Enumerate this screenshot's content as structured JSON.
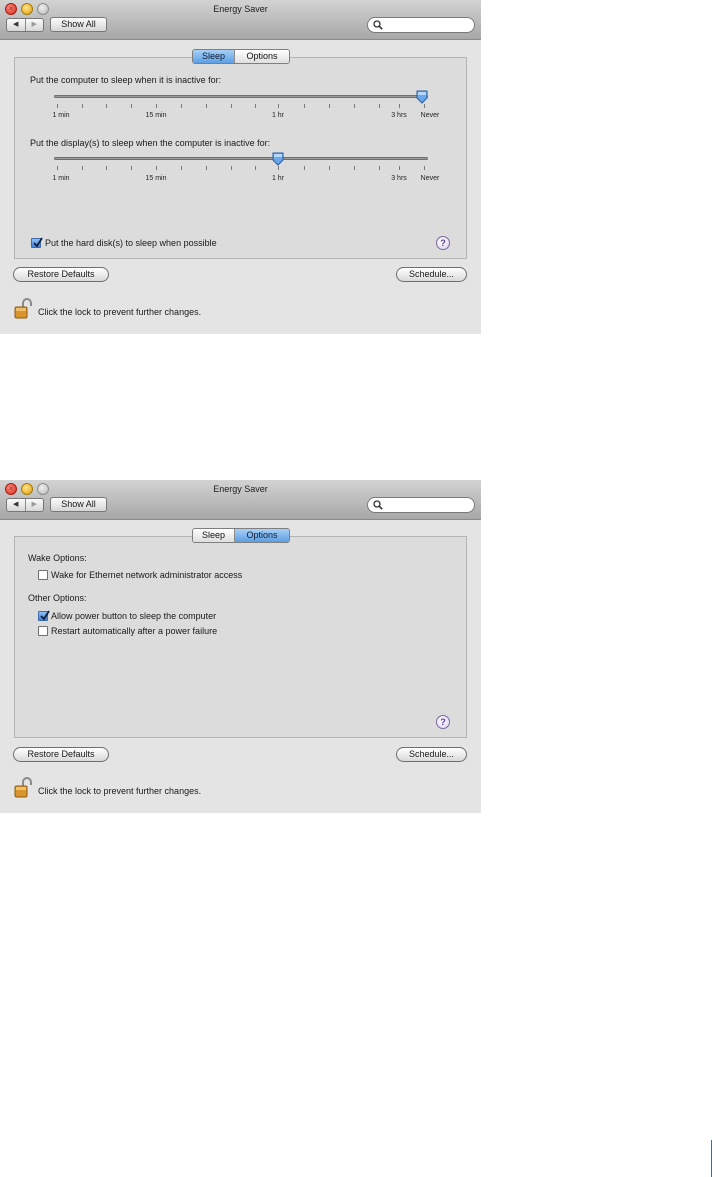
{
  "common": {
    "window_title": "Energy Saver",
    "show_all_label": "Show All",
    "tab_sleep_label": "Sleep",
    "tab_options_label": "Options",
    "restore_defaults_label": "Restore Defaults",
    "schedule_label": "Schedule...",
    "lock_text": "Click the lock to prevent further changes.",
    "help_glyph": "?",
    "icons": {
      "close": "close-light-icon",
      "minimize": "minimize-light-icon",
      "zoom": "zoom-light-icon",
      "back": "back-arrow-icon",
      "forward": "forward-arrow-icon",
      "search": "search-icon",
      "lock": "open-lock-icon",
      "help": "help-icon"
    }
  },
  "sleep_panel": {
    "selected_tab": "Sleep",
    "computer_sleep_label": "Put the computer to sleep when it is inactive for:",
    "computer_sleep_value": "Never",
    "display_sleep_label": "Put the display(s) to sleep when the computer is inactive for:",
    "display_sleep_value": "1 hr",
    "slider_ticks": [
      "1 min",
      "15 min",
      "1 hr",
      "3 hrs",
      "Never"
    ],
    "hard_disk_label": "Put the hard disk(s) to sleep when possible",
    "hard_disk_checked": true
  },
  "options_panel": {
    "selected_tab": "Options",
    "wake_heading": "Wake Options:",
    "wake_ethernet_label": "Wake for Ethernet network administrator access",
    "wake_ethernet_checked": false,
    "other_heading": "Other Options:",
    "power_button_label": "Allow power button to sleep the computer",
    "power_button_checked": true,
    "restart_label": "Restart automatically after a power failure",
    "restart_checked": false
  },
  "colors": {
    "selected_tab": "#5c9fe4",
    "window_bg": "#e4e4e4",
    "panel_bg": "#dcdcdc",
    "side_rule": "#2d6cb8"
  }
}
